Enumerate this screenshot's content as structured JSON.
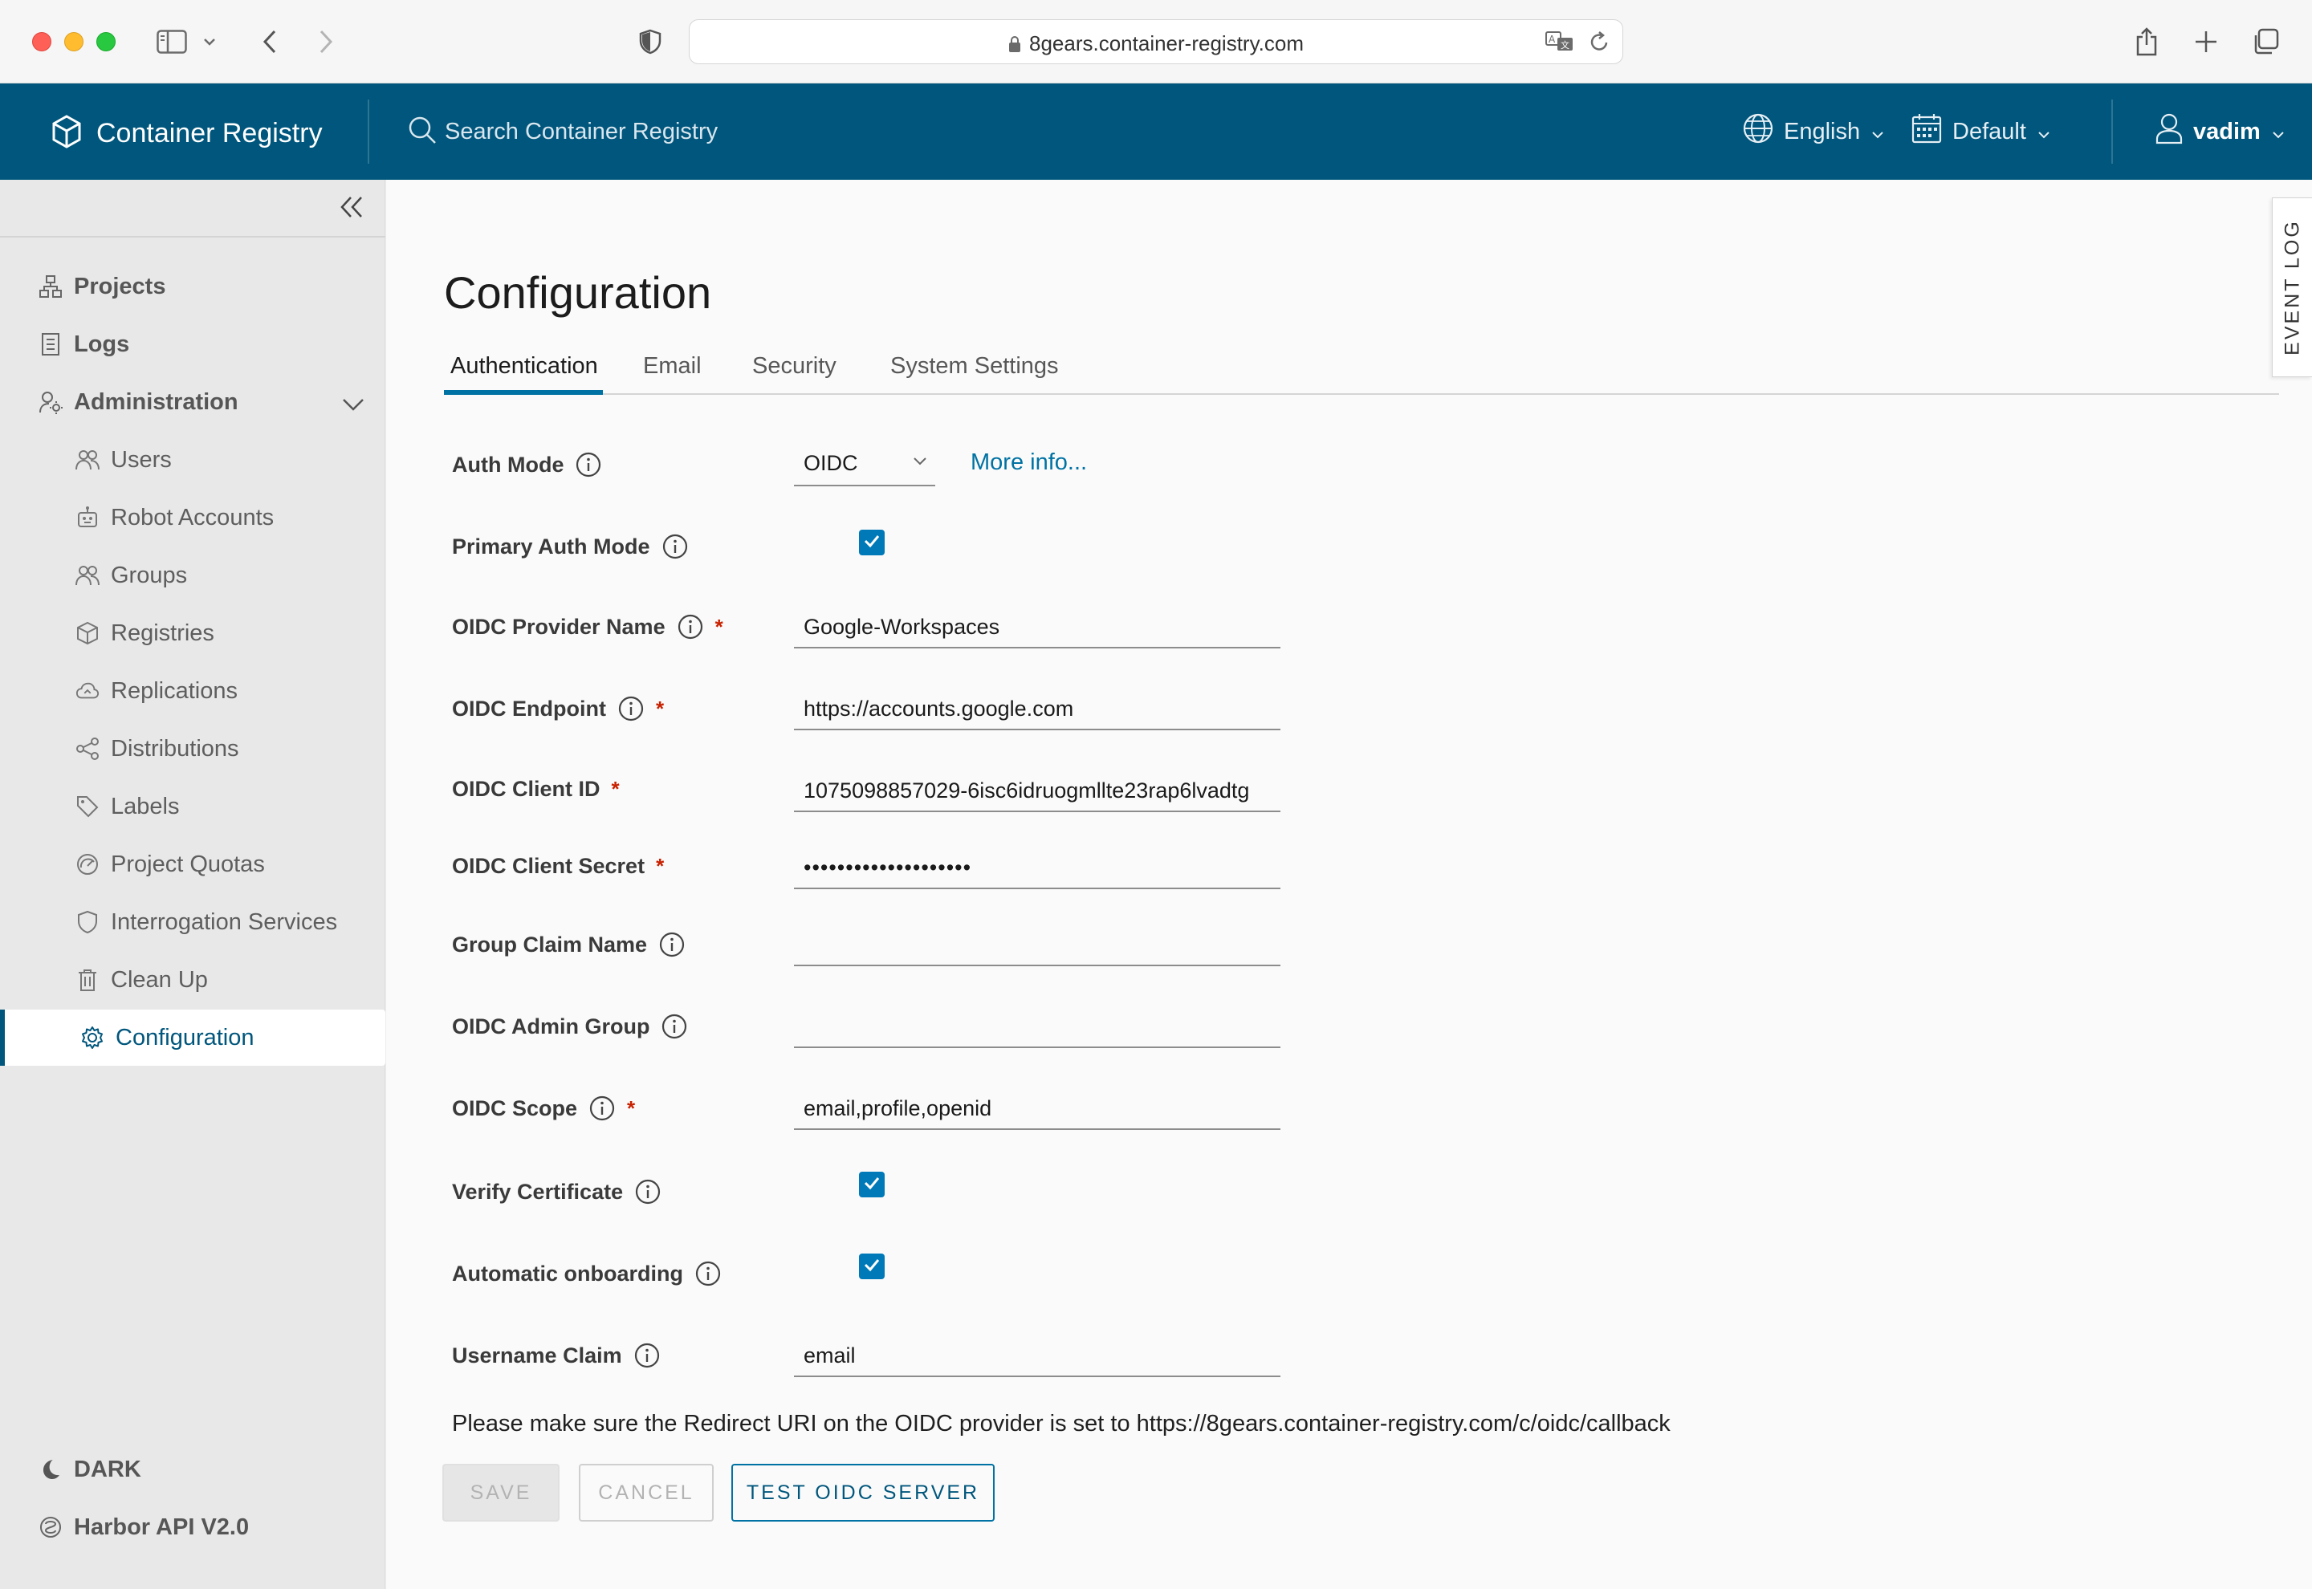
{
  "browser": {
    "url": "8gears.container-registry.com"
  },
  "header": {
    "brand": "Container Registry",
    "search_placeholder": "Search Container Registry",
    "language": "English",
    "theme_menu": "Default",
    "user": "vadim"
  },
  "sidebar": {
    "items": [
      {
        "label": "Projects",
        "icon": "projects-icon"
      },
      {
        "label": "Logs",
        "icon": "logs-icon"
      },
      {
        "label": "Administration",
        "icon": "administration-icon"
      }
    ],
    "admin_items": [
      {
        "label": "Users",
        "icon": "users-icon"
      },
      {
        "label": "Robot Accounts",
        "icon": "robot-icon"
      },
      {
        "label": "Groups",
        "icon": "groups-icon"
      },
      {
        "label": "Registries",
        "icon": "registries-icon"
      },
      {
        "label": "Replications",
        "icon": "replications-icon"
      },
      {
        "label": "Distributions",
        "icon": "distributions-icon"
      },
      {
        "label": "Labels",
        "icon": "labels-icon"
      },
      {
        "label": "Project Quotas",
        "icon": "quotas-icon"
      },
      {
        "label": "Interrogation Services",
        "icon": "shield-icon"
      },
      {
        "label": "Clean Up",
        "icon": "trash-icon"
      },
      {
        "label": "Configuration",
        "icon": "gear-icon"
      }
    ],
    "dark_label": "DARK",
    "api_label": "Harbor API V2.0"
  },
  "main": {
    "title": "Configuration",
    "tabs": [
      {
        "label": "Authentication"
      },
      {
        "label": "Email"
      },
      {
        "label": "Security"
      },
      {
        "label": "System Settings"
      }
    ],
    "form": {
      "auth_mode": {
        "label": "Auth Mode",
        "value": "OIDC",
        "more_info": "More info..."
      },
      "primary_auth_mode": {
        "label": "Primary Auth Mode",
        "checked": true
      },
      "provider_name": {
        "label": "OIDC Provider Name",
        "value": "Google-Workspaces"
      },
      "endpoint": {
        "label": "OIDC Endpoint",
        "value": "https://accounts.google.com"
      },
      "client_id": {
        "label": "OIDC Client ID",
        "value": "1075098857029-6isc6idruogmllte23rap6lvadtg"
      },
      "client_secret": {
        "label": "OIDC Client Secret",
        "value": "••••••••••••••••••••"
      },
      "group_claim": {
        "label": "Group Claim Name",
        "value": ""
      },
      "admin_group": {
        "label": "OIDC Admin Group",
        "value": ""
      },
      "scope": {
        "label": "OIDC Scope",
        "value": "email,profile,openid"
      },
      "verify_cert": {
        "label": "Verify Certificate",
        "checked": true
      },
      "auto_onboarding": {
        "label": "Automatic onboarding",
        "checked": true
      },
      "username_claim": {
        "label": "Username Claim",
        "value": "email"
      }
    },
    "redirect_notice": "Please make sure the Redirect URI on the OIDC provider is set to https://8gears.container-registry.com/c/oidc/callback",
    "buttons": {
      "save": "SAVE",
      "cancel": "CANCEL",
      "test": "TEST OIDC SERVER"
    }
  },
  "event_log": "EVENT LOG",
  "colors": {
    "header": "#00567c",
    "accent": "#0072a3",
    "checkbox": "#0079b8",
    "required": "#c92100"
  }
}
